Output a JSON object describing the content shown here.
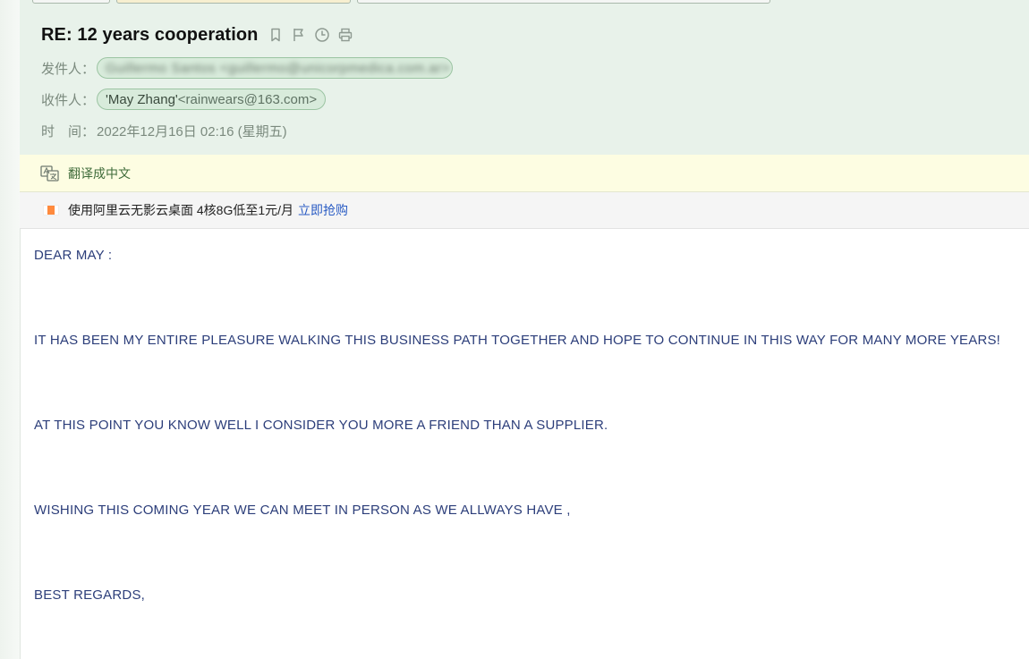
{
  "mail": {
    "subject": "RE: 12 years cooperation",
    "from_label": "发件人：",
    "from_value_blurred": "Guillermo Santos <guillermo@unicorpmedica.com.ar>",
    "to_label": "收件人：",
    "to_name": "'May Zhang'",
    "to_address": "<rainwears@163.com>",
    "time_label": "时　间：",
    "time_value": "2022年12月16日 02:16 (星期五)",
    "icons": [
      "bookmark-icon",
      "flag-icon",
      "clock-icon",
      "print-icon"
    ]
  },
  "translate_bar": {
    "label": "翻译成中文",
    "icon": "translate-icon"
  },
  "ad_bar": {
    "text": "使用阿里云无影云桌面 4核8G低至1元/月",
    "link": "立即抢购"
  },
  "body": {
    "paragraphs": [
      "DEAR MAY :",
      "IT HAS BEEN MY ENTIRE PLEASURE WALKING THIS BUSINESS PATH TOGETHER AND HOPE TO CONTINUE IN THIS WAY FOR MANY MORE YEARS!",
      "AT THIS POINT YOU KNOW WELL I CONSIDER YOU MORE A FRIEND THAN A SUPPLIER.",
      "WISHING THIS COMING YEAR WE CAN MEET IN PERSON AS WE ALLWAYS HAVE ,",
      "BEST REGARDS,"
    ]
  },
  "colors": {
    "header_bg": "#e8f2ea",
    "chip_bg": "#d8ebdb",
    "chip_border": "#9bc4a2",
    "translate_bg": "#fdfde2",
    "body_text": "#2c3e7a",
    "link": "#2a5cc4"
  }
}
